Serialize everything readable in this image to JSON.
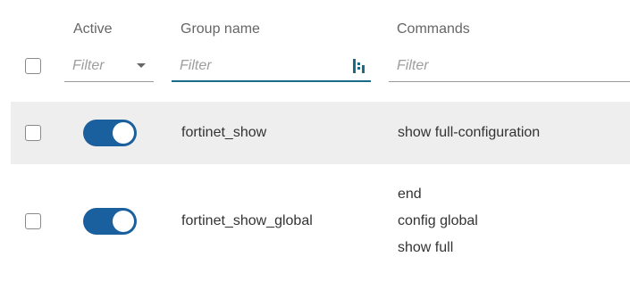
{
  "columns": {
    "active": "Active",
    "group_name": "Group name",
    "commands": "Commands"
  },
  "filters": {
    "active_placeholder": "Filter",
    "group_placeholder": "Filter",
    "commands_placeholder": "Filter"
  },
  "rows": [
    {
      "selected": false,
      "active": true,
      "group_name": "fortinet_show",
      "commands": [
        "show full-configuration"
      ]
    },
    {
      "selected": false,
      "active": true,
      "group_name": "fortinet_show_global",
      "commands": [
        "end",
        "config global",
        "show full"
      ]
    }
  ],
  "colors": {
    "toggle_on": "#1a5f9e",
    "focused_underline": "#1a6b84",
    "row_highlight": "#eeeeee"
  },
  "icons": {
    "active_filter_dropdown": "caret-down-icon",
    "group_filter_mode": "filter-mode-icon"
  }
}
